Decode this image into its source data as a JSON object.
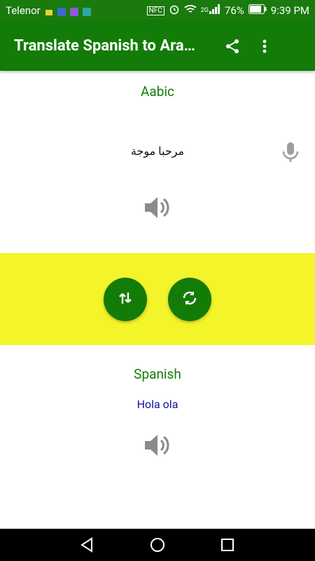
{
  "status_bar": {
    "carrier": "Telenor",
    "battery": "76%",
    "time": "9:39 PM",
    "signal_label": "2G",
    "nfc_label": "NFC"
  },
  "app_bar": {
    "title": "Translate Spanish to Ara…",
    "share_icon": "share-icon",
    "menu_icon": "more-vert-icon"
  },
  "source": {
    "language": "Aabic",
    "text": "مرحبا موجة",
    "mic_icon": "mic-icon",
    "speaker_icon": "speaker-icon"
  },
  "actions": {
    "swap_icon": "swap-vertical-icon",
    "translate_icon": "sync-icon",
    "band_color": "#f4f42b",
    "button_color": "#137b07"
  },
  "target": {
    "language": "Spanish",
    "text": "Hola ola",
    "speaker_icon": "speaker-icon"
  },
  "nav": {
    "back_icon": "back-triangle-icon",
    "home_icon": "home-circle-icon",
    "recents_icon": "recents-square-icon"
  }
}
